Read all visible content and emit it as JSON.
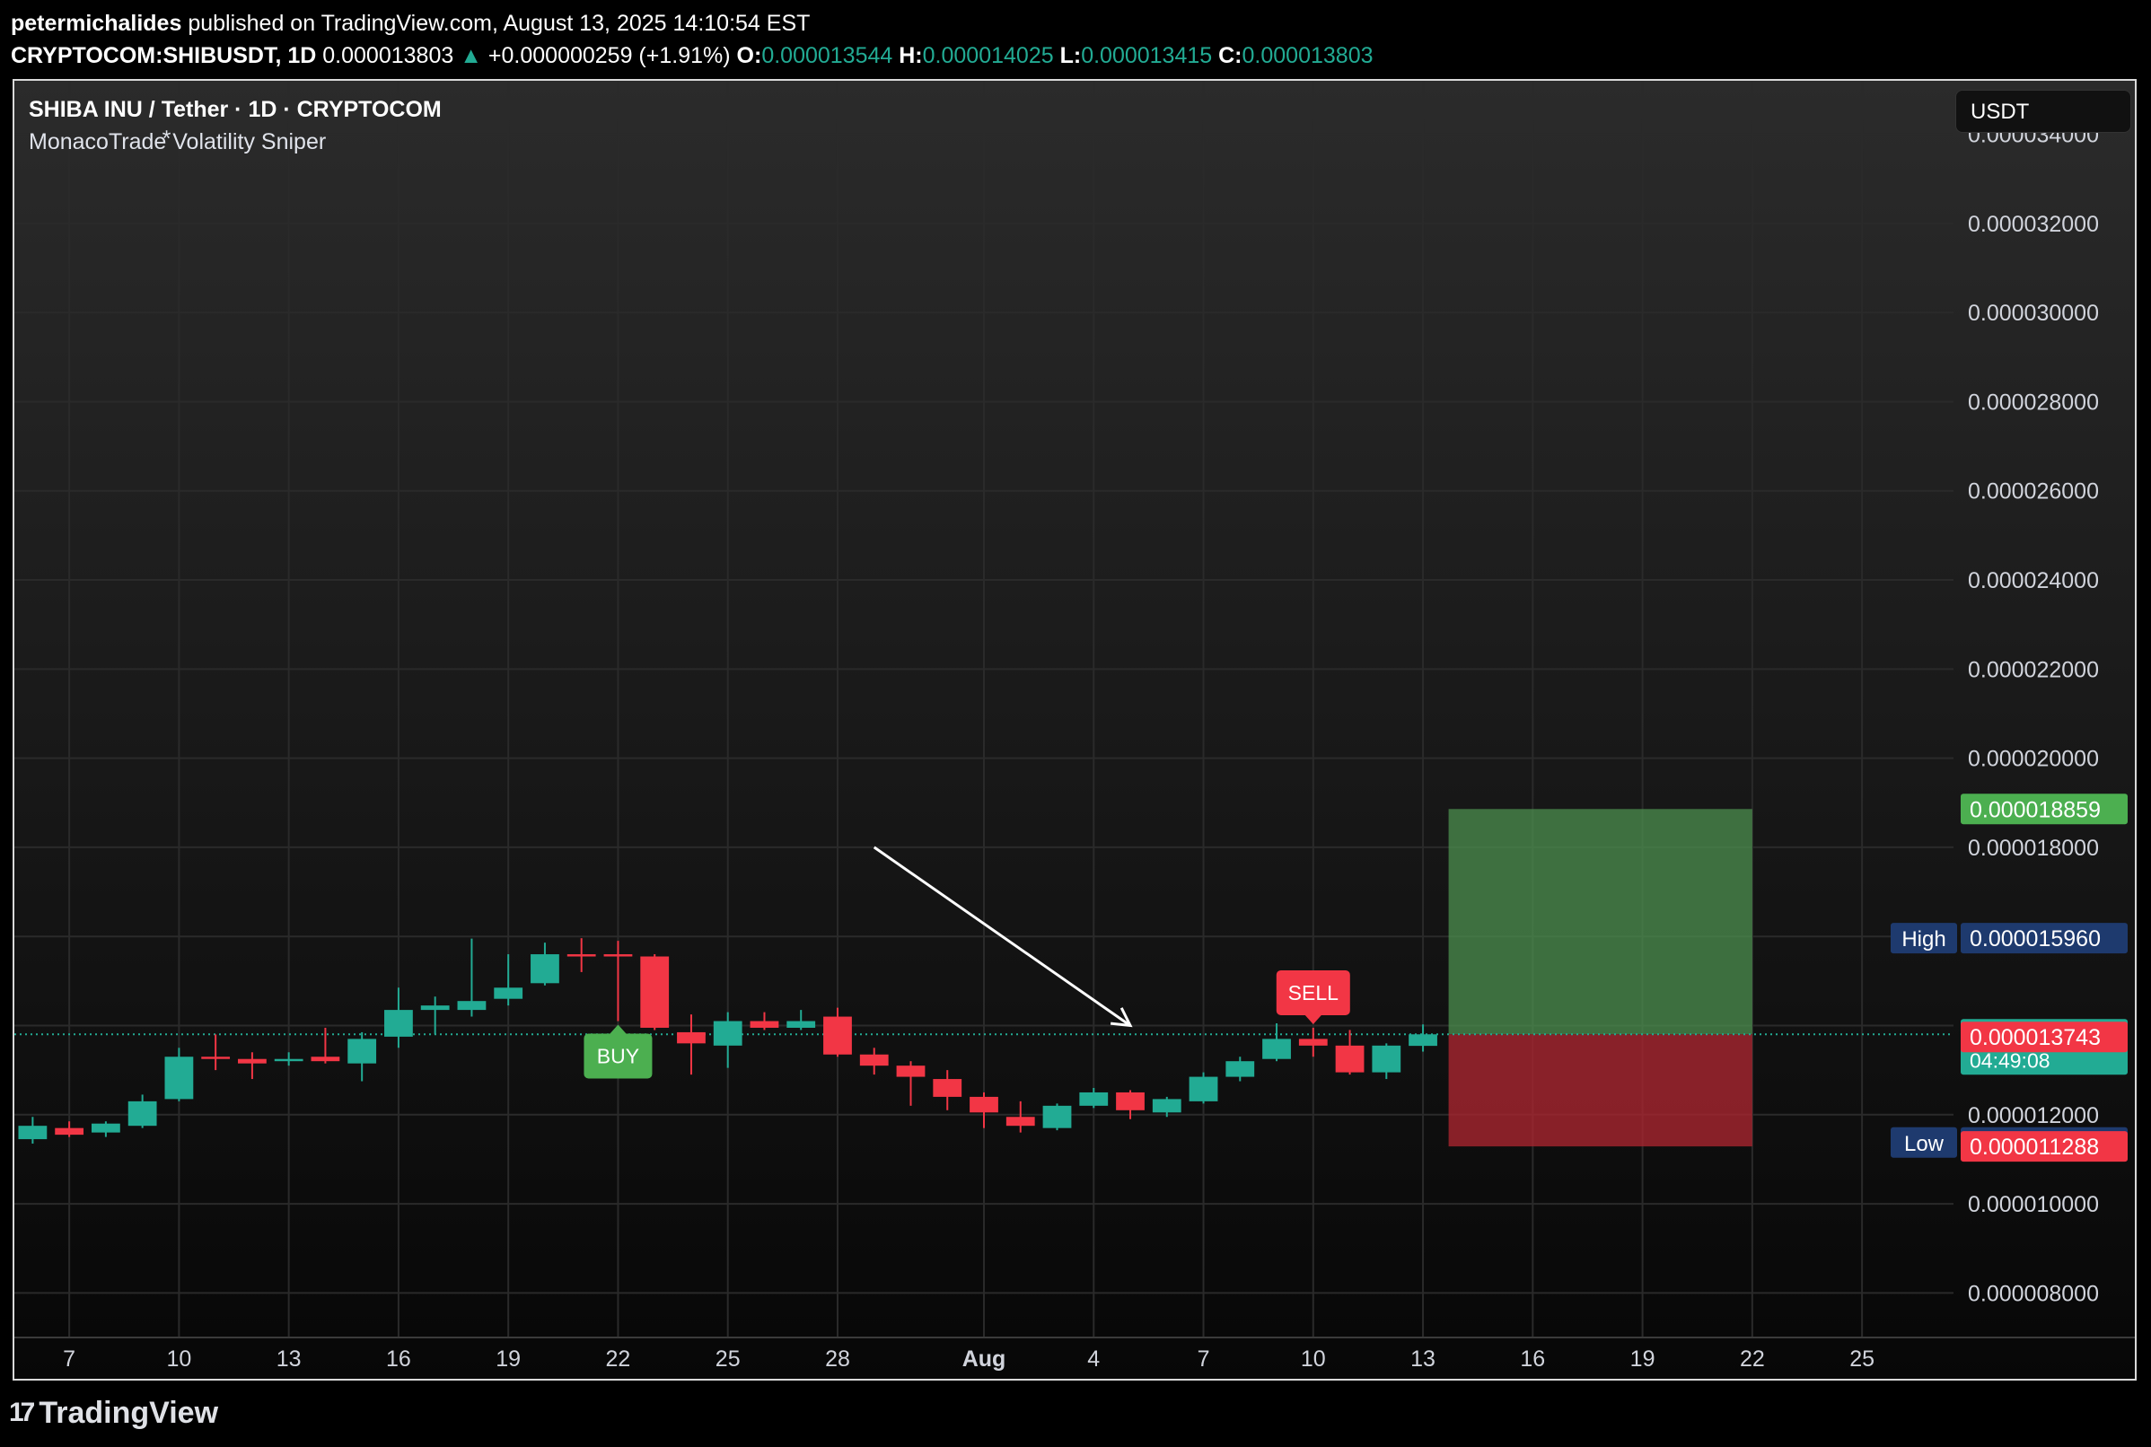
{
  "header": {
    "publisher": "petermichalides",
    "published_text": "published on TradingView.com, August 13, 2025 14:10:54 EST",
    "symbol_line": "CRYPTOCOM:SHIBUSDT, 1D",
    "last_price": "0.000013803",
    "change": "+0.000000259 (+1.91%)",
    "o_label": "O:",
    "o_value": "0.000013544",
    "h_label": "H:",
    "h_value": "0.000014025",
    "l_label": "L:",
    "l_value": "0.000013415",
    "c_label": "C:",
    "c_value": "0.000013803"
  },
  "legend": {
    "symbol": "SHIBA INU / Tether · 1D · CRYPTOCOM",
    "indicator": "MonacoTrade⃰ Volatility Sniper"
  },
  "currency_button": "USDT",
  "footer": {
    "brand": "TradingView",
    "logo_icon": "tradingview-logo-icon"
  },
  "colors": {
    "up": "#22ab94",
    "down": "#f23645",
    "buy": "#4caf50",
    "sell": "#f23645",
    "target": "#4c8f4f",
    "stop": "#a7262f",
    "high_low_bg": "#1e3a6e"
  },
  "chart_data": {
    "type": "candlestick",
    "ylim": [
      7e-06,
      3.52e-05
    ],
    "y_ticks": [
      {
        "value": 3.4e-05,
        "label": "0.000034000"
      },
      {
        "value": 3.2e-05,
        "label": "0.000032000"
      },
      {
        "value": 3e-05,
        "label": "0.000030000"
      },
      {
        "value": 2.8e-05,
        "label": "0.000028000"
      },
      {
        "value": 2.6e-05,
        "label": "0.000026000"
      },
      {
        "value": 2.4e-05,
        "label": "0.000024000"
      },
      {
        "value": 2.2e-05,
        "label": "0.000022000"
      },
      {
        "value": 2e-05,
        "label": "0.000020000"
      },
      {
        "value": 1.8e-05,
        "label": "0.000018000"
      },
      {
        "value": 1.2e-05,
        "label": "0.000012000"
      },
      {
        "value": 1e-05,
        "label": "0.000010000"
      },
      {
        "value": 8e-06,
        "label": "0.000008000"
      }
    ],
    "x_ticks": [
      {
        "day": 7,
        "label": "7"
      },
      {
        "day": 10,
        "label": "10"
      },
      {
        "day": 13,
        "label": "13"
      },
      {
        "day": 16,
        "label": "16"
      },
      {
        "day": 19,
        "label": "19"
      },
      {
        "day": 22,
        "label": "22"
      },
      {
        "day": 25,
        "label": "25"
      },
      {
        "day": 28,
        "label": "28"
      },
      {
        "day": 32,
        "label": "Aug",
        "bold": true
      },
      {
        "day": 35,
        "label": "4"
      },
      {
        "day": 38,
        "label": "7"
      },
      {
        "day": 41,
        "label": "10"
      },
      {
        "day": 44,
        "label": "13"
      },
      {
        "day": 47,
        "label": "16"
      },
      {
        "day": 50,
        "label": "19"
      },
      {
        "day": 53,
        "label": "22"
      },
      {
        "day": 56,
        "label": "25"
      }
    ],
    "x_range": [
      5.5,
      58.5
    ],
    "candles": [
      {
        "day": 6,
        "o": 11.45,
        "h": 11.95,
        "l": 11.35,
        "c": 11.75
      },
      {
        "day": 7,
        "o": 11.7,
        "h": 11.85,
        "l": 11.5,
        "c": 11.55
      },
      {
        "day": 8,
        "o": 11.6,
        "h": 11.85,
        "l": 11.5,
        "c": 11.8
      },
      {
        "day": 9,
        "o": 11.75,
        "h": 12.45,
        "l": 11.7,
        "c": 12.3
      },
      {
        "day": 10,
        "o": 12.35,
        "h": 13.5,
        "l": 12.3,
        "c": 13.3
      },
      {
        "day": 11,
        "o": 13.3,
        "h": 13.8,
        "l": 13.0,
        "c": 13.25
      },
      {
        "day": 12,
        "o": 13.25,
        "h": 13.4,
        "l": 12.8,
        "c": 13.15
      },
      {
        "day": 13,
        "o": 13.2,
        "h": 13.4,
        "l": 13.1,
        "c": 13.25
      },
      {
        "day": 14,
        "o": 13.3,
        "h": 13.95,
        "l": 13.15,
        "c": 13.2
      },
      {
        "day": 15,
        "o": 13.15,
        "h": 13.85,
        "l": 12.75,
        "c": 13.7
      },
      {
        "day": 16,
        "o": 13.75,
        "h": 14.85,
        "l": 13.5,
        "c": 14.35
      },
      {
        "day": 17,
        "o": 14.35,
        "h": 14.65,
        "l": 13.8,
        "c": 14.45
      },
      {
        "day": 18,
        "o": 14.35,
        "h": 15.95,
        "l": 14.2,
        "c": 14.55
      },
      {
        "day": 19,
        "o": 14.6,
        "h": 15.6,
        "l": 14.45,
        "c": 14.85
      },
      {
        "day": 20,
        "o": 14.95,
        "h": 15.86,
        "l": 14.9,
        "c": 15.6
      },
      {
        "day": 21,
        "o": 15.6,
        "h": 15.96,
        "l": 15.2,
        "c": 15.55
      },
      {
        "day": 22,
        "o": 15.6,
        "h": 15.9,
        "l": 14.1,
        "c": 15.55
      },
      {
        "day": 23,
        "o": 15.55,
        "h": 15.6,
        "l": 13.9,
        "c": 13.95
      },
      {
        "day": 24,
        "o": 13.85,
        "h": 14.25,
        "l": 12.9,
        "c": 13.6
      },
      {
        "day": 25,
        "o": 13.55,
        "h": 14.3,
        "l": 13.05,
        "c": 14.1
      },
      {
        "day": 26,
        "o": 14.1,
        "h": 14.3,
        "l": 13.9,
        "c": 13.95
      },
      {
        "day": 27,
        "o": 13.95,
        "h": 14.35,
        "l": 13.9,
        "c": 14.1
      },
      {
        "day": 28,
        "o": 14.2,
        "h": 14.4,
        "l": 13.3,
        "c": 13.35
      },
      {
        "day": 29,
        "o": 13.35,
        "h": 13.5,
        "l": 12.9,
        "c": 13.1
      },
      {
        "day": 30,
        "o": 13.1,
        "h": 13.2,
        "l": 12.2,
        "c": 12.85
      },
      {
        "day": 31,
        "o": 12.8,
        "h": 13.0,
        "l": 12.1,
        "c": 12.4
      },
      {
        "day": 32,
        "o": 12.4,
        "h": 12.5,
        "l": 11.7,
        "c": 12.05
      },
      {
        "day": 33,
        "o": 11.95,
        "h": 12.3,
        "l": 11.6,
        "c": 11.75
      },
      {
        "day": 34,
        "o": 11.7,
        "h": 12.25,
        "l": 11.65,
        "c": 12.2
      },
      {
        "day": 35,
        "o": 12.2,
        "h": 12.6,
        "l": 12.15,
        "c": 12.5
      },
      {
        "day": 36,
        "o": 12.5,
        "h": 12.55,
        "l": 11.9,
        "c": 12.1
      },
      {
        "day": 37,
        "o": 12.05,
        "h": 12.4,
        "l": 11.95,
        "c": 12.35
      },
      {
        "day": 38,
        "o": 12.3,
        "h": 12.95,
        "l": 12.25,
        "c": 12.85
      },
      {
        "day": 39,
        "o": 12.85,
        "h": 13.3,
        "l": 12.75,
        "c": 13.2
      },
      {
        "day": 40,
        "o": 13.25,
        "h": 14.05,
        "l": 13.2,
        "c": 13.7
      },
      {
        "day": 41,
        "o": 13.7,
        "h": 13.95,
        "l": 13.3,
        "c": 13.55
      },
      {
        "day": 42,
        "o": 13.55,
        "h": 13.9,
        "l": 12.9,
        "c": 12.95
      },
      {
        "day": 43,
        "o": 12.95,
        "h": 13.6,
        "l": 12.8,
        "c": 13.55
      },
      {
        "day": 44,
        "o": 13.544,
        "h": 14.025,
        "l": 13.415,
        "c": 13.803
      }
    ],
    "price_unit": "1e-6",
    "current_price": 1.3803e-05,
    "signals": [
      {
        "type": "BUY",
        "day": 22,
        "label": "BUY"
      },
      {
        "type": "SELL",
        "day": 41,
        "label": "SELL"
      }
    ],
    "arrow": {
      "from": {
        "day": 29,
        "price": 1.8e-05
      },
      "to": {
        "day": 36,
        "price": 1.4e-05
      }
    },
    "position": {
      "start_day": 45,
      "end_day": 53,
      "entry": 1.3803e-05,
      "target": 1.8859e-05,
      "stop": 1.1288e-05
    },
    "price_labels": [
      {
        "name": "target-price-label",
        "price": 1.8859e-05,
        "text": "0.000018859",
        "bg": "#4caf50"
      },
      {
        "name": "high-price-label",
        "price": 1.596e-05,
        "text": "0.000015960",
        "tag": "High",
        "bg": "#1e3a6e"
      },
      {
        "name": "last-price-label",
        "price": 1.3803e-05,
        "text": "0.000013803",
        "subtext": "04:49:08",
        "bg": "#22ab94"
      },
      {
        "name": "entry-red-price-label",
        "price": 1.3743e-05,
        "text": "0.000013743",
        "bg": "#f23645"
      },
      {
        "name": "low-price-label",
        "price": 1.1375e-05,
        "text": "0.000011375",
        "tag": "Low",
        "bg": "#1e3a6e"
      },
      {
        "name": "stop-price-label",
        "price": 1.1288e-05,
        "text": "0.000011288",
        "bg": "#f23645"
      }
    ]
  }
}
